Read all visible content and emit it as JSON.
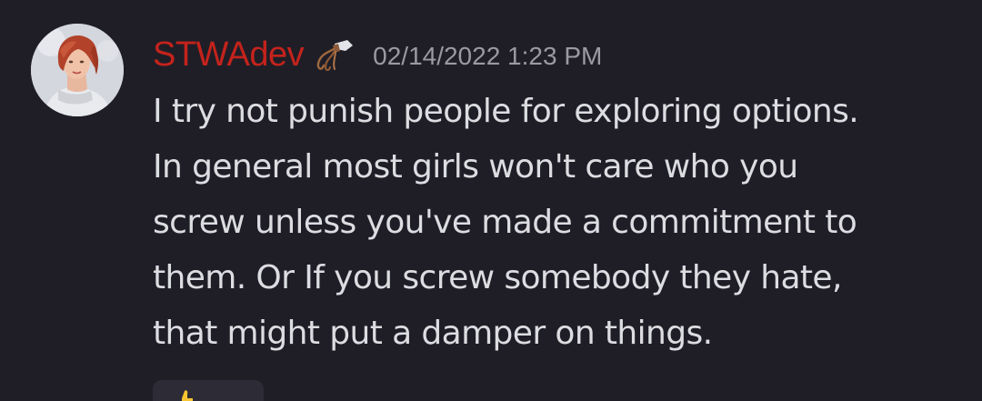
{
  "message": {
    "author": {
      "name": "STWAdev",
      "name_color": "#c4231c",
      "avatar_icon": "avatar-redhead-portrait",
      "role_icon": "whip-icon"
    },
    "timestamp": "02/14/2022 1:23 PM",
    "content_lines": [
      "I try not punish people for exploring options.",
      "In general most girls won't care who you",
      "screw unless you've made a commitment to",
      "them. Or If you screw somebody they hate,",
      "that might put a damper on things."
    ],
    "reaction": {
      "emoji_icon": "thumbs-up-icon"
    }
  }
}
